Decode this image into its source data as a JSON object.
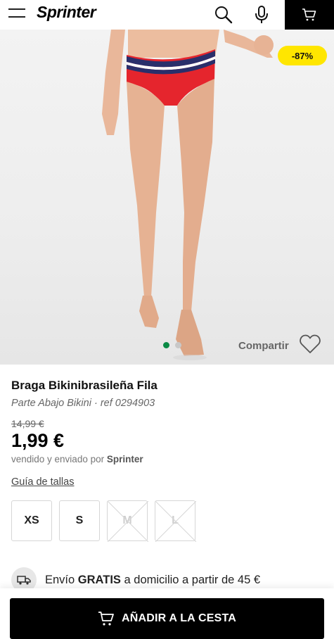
{
  "header": {
    "logo_text": "Sprinter",
    "menu_icon": "hamburger-menu-icon",
    "search_icon": "search-icon",
    "mic_icon": "microphone-icon",
    "cart_icon": "cart-icon"
  },
  "hero": {
    "discount_badge": "-87%",
    "share_label": "Compartir",
    "gallery_dots": [
      {
        "active": true
      },
      {
        "active": false
      }
    ],
    "heart_icon": "heart-icon"
  },
  "product": {
    "title": "Braga Bikinibrasileña Fila",
    "category": "Parte Abajo Bikini",
    "ref": "ref 0294903",
    "old_price": "14,99 €",
    "price": "1,99 €",
    "seller_prefix": "vendido y enviado por",
    "seller_name": "Sprinter",
    "size_guide_label": "Guía de tallas",
    "sizes": [
      {
        "label": "XS",
        "available": true
      },
      {
        "label": "S",
        "available": true
      },
      {
        "label": "M",
        "available": false
      },
      {
        "label": "L",
        "available": false
      }
    ]
  },
  "shipping": {
    "icon": "delivery-truck-icon",
    "text_prefix": "Envío",
    "text_bold": "GRATIS",
    "text_suffix": "a domicilio a partir de 45 €"
  },
  "cta": {
    "add_to_cart_label": "AÑADIR A LA CESTA",
    "icon": "cart-icon"
  },
  "colors": {
    "accent_yellow": "#ffe600",
    "active_dot_green": "#0a8a45",
    "button_black": "#000000"
  }
}
